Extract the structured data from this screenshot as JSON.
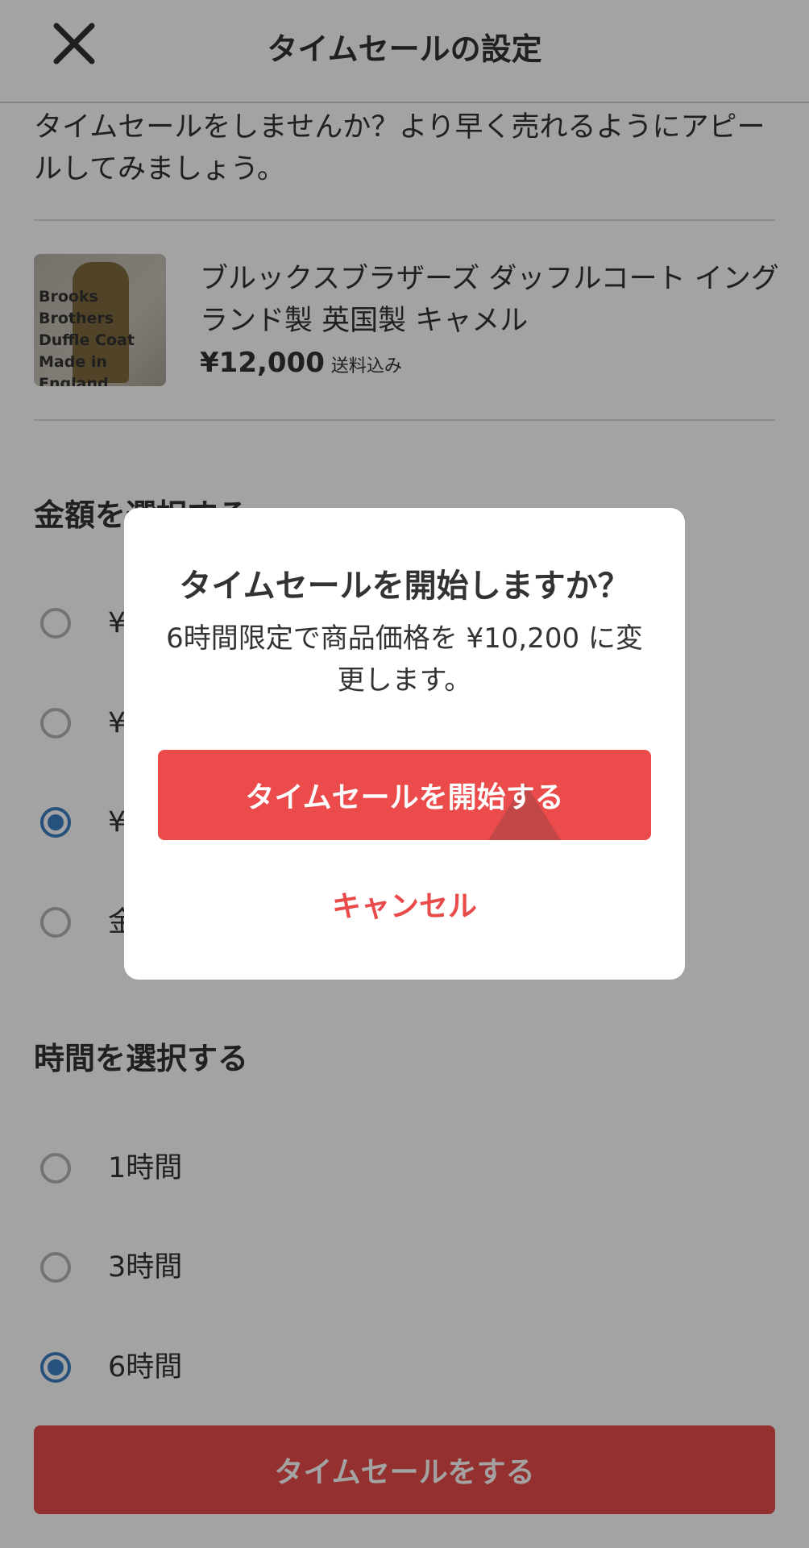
{
  "header": {
    "title": "タイムセールの設定",
    "close_icon": "close-icon"
  },
  "intro": "タイムセールをしませんか？より早く売れるようにアピールしてみましょう。",
  "product": {
    "thumb_text": [
      "Brooks Brothers",
      "Duffle Coat",
      "Made in England"
    ],
    "name": "ブルックスブラザーズ ダッフルコート イングランド製 英国製 キャメル",
    "price": "¥12,000",
    "price_note": "送料込み"
  },
  "amount_section": {
    "title": "金額を選択する",
    "options": [
      {
        "label": "¥",
        "selected": false
      },
      {
        "label": "¥",
        "selected": false
      },
      {
        "label": "¥",
        "selected": true
      },
      {
        "label": "金",
        "selected": false
      }
    ]
  },
  "time_section": {
    "title": "時間を選択する",
    "options": [
      {
        "label": "1時間",
        "selected": false
      },
      {
        "label": "3時間",
        "selected": false
      },
      {
        "label": "6時間",
        "selected": true
      }
    ]
  },
  "cta_label": "タイムセールをする",
  "modal": {
    "title": "タイムセールを開始しますか？",
    "message": "6時間限定で商品価格を ¥10,200 に変更します。",
    "confirm_label": "タイムセールを開始する",
    "cancel_label": "キャンセル"
  },
  "colors": {
    "accent": "#E94B4B",
    "radio_selected": "#3C7FC4",
    "overlay": "rgba(0,0,0,0.36)"
  }
}
